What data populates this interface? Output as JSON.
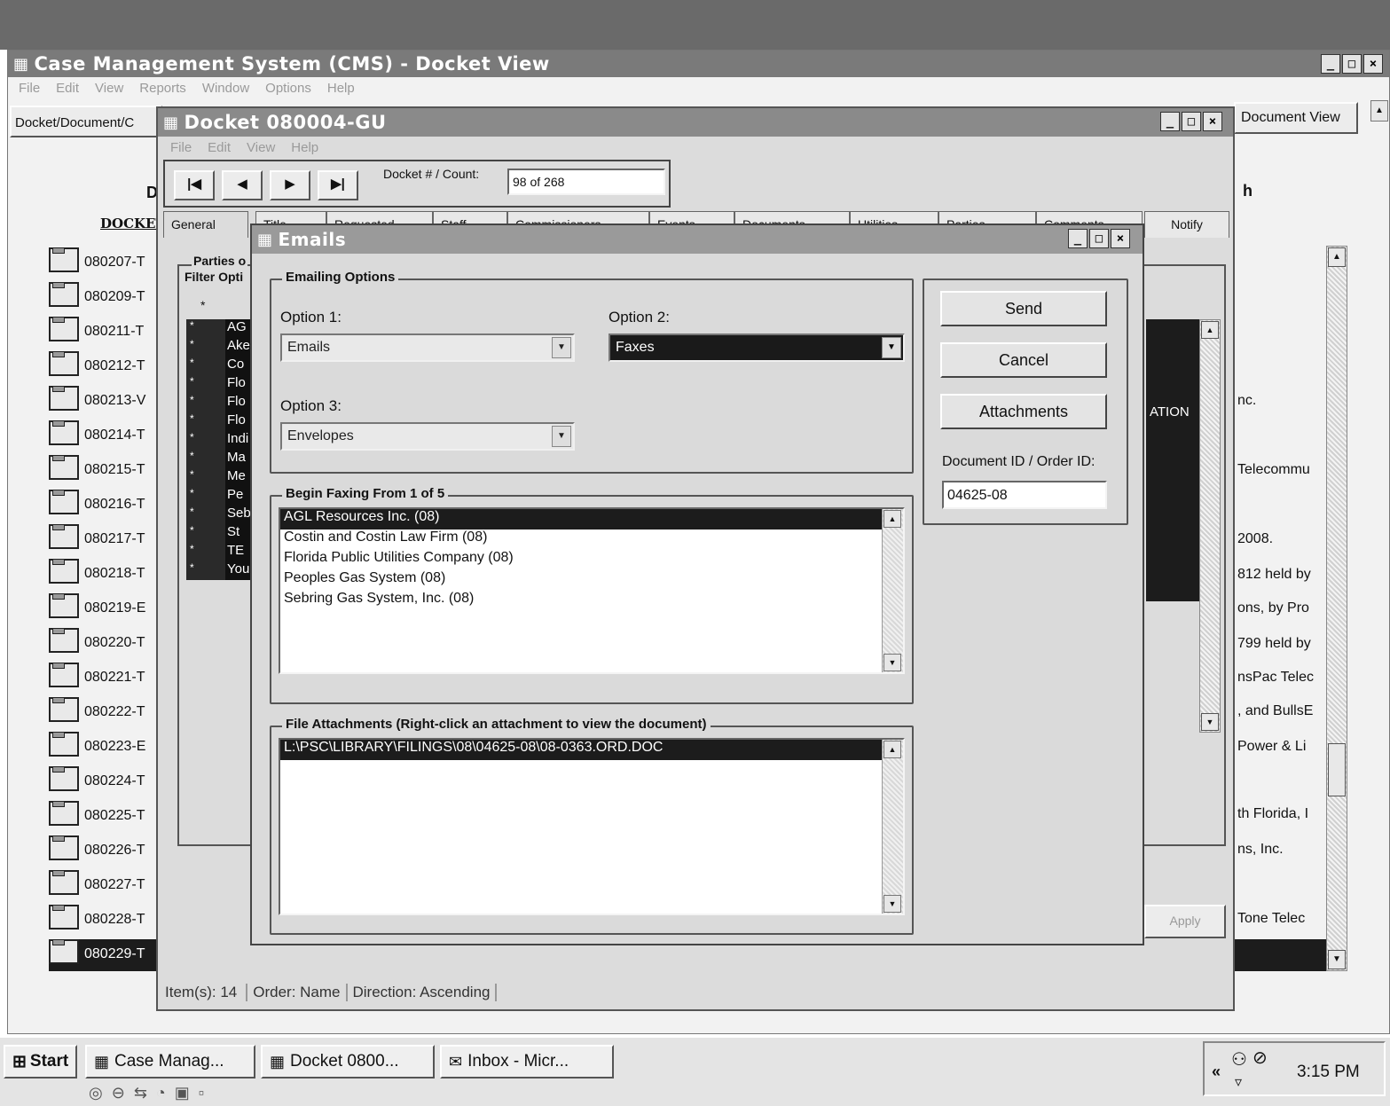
{
  "cms_window": {
    "title": "Case Management System (CMS) - Docket View",
    "menu": [
      "File",
      "Edit",
      "View",
      "Reports",
      "Window",
      "Options",
      "Help"
    ],
    "breadcrumb": "Docket/Document/C",
    "document_view_button": "Document View",
    "partial_heading_left": "D",
    "partial_heading_right": "h",
    "column_header": "DOCKET",
    "dockets": [
      "080207-T",
      "080209-T",
      "080211-T",
      "080212-T",
      "080213-V",
      "080214-T",
      "080215-T",
      "080216-T",
      "080217-T",
      "080218-T",
      "080219-E",
      "080220-T",
      "080221-T",
      "080222-T",
      "080223-E",
      "080224-T",
      "080225-T",
      "080226-T",
      "080227-T",
      "080228-T",
      "080229-T"
    ],
    "right_fragments": [
      "nc.",
      "Telecommu",
      "2008.",
      "812 held by",
      "ons, by Pro",
      "799 held by",
      "nsPac Telec",
      ", and BullsE",
      "Power & Li",
      "th Florida, I",
      "ns, Inc.",
      "Tone Telec"
    ]
  },
  "docket_window": {
    "title": "Docket 080004-GU",
    "menu": [
      "File",
      "Edit",
      "View",
      "Help"
    ],
    "nav_buttons": [
      "first",
      "prev",
      "next",
      "last"
    ],
    "count_label": "Docket # / Count:",
    "count_value": "98 of 268",
    "tabs": [
      "General",
      "Title",
      "Requested",
      "Staff",
      "Commissioners",
      "Events",
      "Documents",
      "Utilities",
      "Parties",
      "Comments",
      "Notify"
    ],
    "parties_group_label": "Parties o",
    "filter_label": "Filter Opti",
    "parties_header_star": "*",
    "parties": [
      "AG",
      "Ake",
      "Co",
      "Flo",
      "Flo",
      "Flo",
      "Indi",
      "Ma",
      "Me",
      "Pe",
      "Seb",
      "St",
      "TE",
      "You"
    ],
    "partial_column_label": "ATION",
    "apply_button": "Apply",
    "status": {
      "items": "Item(s): 14",
      "order": "Order: Name",
      "direction": "Direction: Ascending"
    }
  },
  "emails_dialog": {
    "title": "Emails",
    "options_group": "Emailing Options",
    "option1_label": "Option 1:",
    "option1_value": "Emails",
    "option2_label": "Option 2:",
    "option2_value": "Faxes",
    "option3_label": "Option 3:",
    "option3_value": "Envelopes",
    "recipients_group": "Begin Faxing From 1 of 5",
    "recipients": [
      "AGL Resources Inc. (08)",
      "Costin and Costin Law Firm (08)",
      "Florida Public Utilities Company (08)",
      "Peoples Gas System (08)",
      "Sebring Gas System, Inc. (08)"
    ],
    "attachments_group": "File Attachments (Right-click an attachment to view the document)",
    "attachments": [
      "L:\\PSC\\LIBRARY\\FILINGS\\08\\04625-08\\08-0363.ORD.DOC"
    ],
    "send_button": "Send",
    "cancel_button": "Cancel",
    "attachments_button": "Attachments",
    "doc_id_label": "Document ID / Order ID:",
    "doc_id_value": "04625-08"
  },
  "taskbar": {
    "start_label": "Start",
    "tasks": [
      "Case Manag...",
      "Docket 0800...",
      "Inbox - Micr..."
    ],
    "clock": "3:15 PM",
    "chevron": "«"
  },
  "colors": {
    "title_bar": "#5a5a5a",
    "selection": "#1c1c1c",
    "dialog_bg": "#dadada"
  }
}
